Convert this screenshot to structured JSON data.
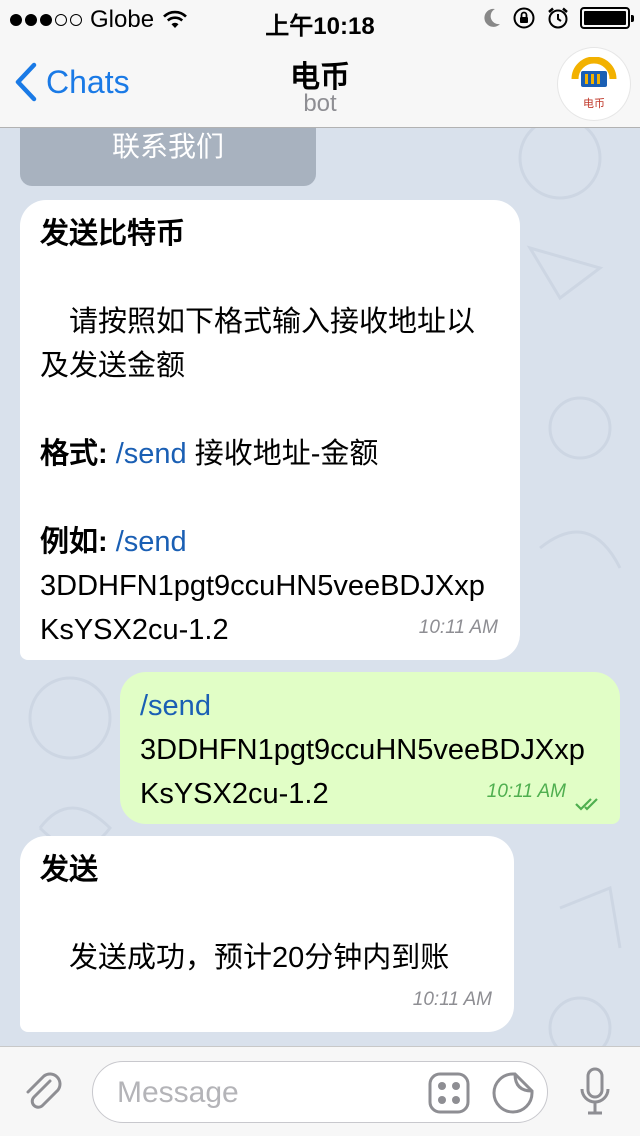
{
  "status_bar": {
    "carrier": "Globe",
    "time": "上午10:18"
  },
  "nav": {
    "back_label": "Chats",
    "title": "电币",
    "subtitle": "bot",
    "avatar_text": "电币"
  },
  "inline_button": {
    "label": "联系我们"
  },
  "messages": [
    {
      "title": "发送比特币",
      "body": "　请按照如下格式输入接收地址以及发送金额",
      "format_label": "格式: ",
      "format_cmd": "/send",
      "format_rest": " 接收地址-金额",
      "example_label": "例如: ",
      "example_cmd": "/send",
      "example_value": "3DDHFN1pgt9ccuHN5veeBDJXxpKsYSX2cu-1.2",
      "time": "10:11 AM"
    },
    {
      "cmd": "/send",
      "value": "3DDHFN1pgt9ccuHN5veeBDJXxpKsYSX2cu-1.2",
      "time": "10:11 AM"
    },
    {
      "title": "发送",
      "body": "　发送成功，预计20分钟内到账",
      "time": "10:11 AM"
    }
  ],
  "input": {
    "placeholder": "Message",
    "value": ""
  },
  "icons": {
    "back": "chevron-left-icon",
    "wifi": "wifi-icon",
    "moon": "moon-icon",
    "lock": "rotation-lock-icon",
    "alarm": "alarm-icon",
    "battery": "battery-icon",
    "attach": "paperclip-icon",
    "commands": "bot-commands-icon",
    "sticker": "sticker-icon",
    "mic": "microphone-icon",
    "read": "double-check-icon"
  },
  "colors": {
    "accent": "#1a7ae6",
    "outgoing_bubble": "#e1fec6",
    "chat_background": "#d9e1ec",
    "command_link": "#1a5fb4",
    "read_check": "#4faf4f"
  }
}
